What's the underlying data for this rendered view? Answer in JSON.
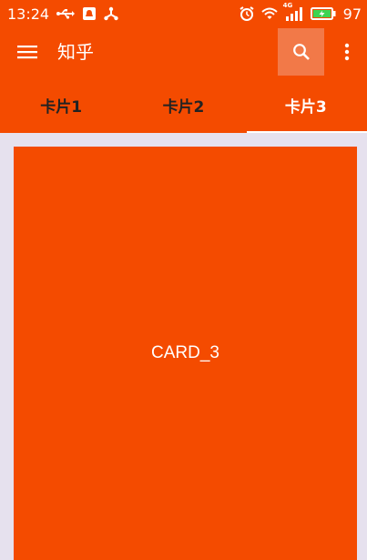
{
  "status_bar": {
    "time": "13:24",
    "battery": "97",
    "left_icons": [
      "usb-icon",
      "notification-icon",
      "share-icon"
    ],
    "right_icons": [
      "alarm-icon",
      "wifi-icon",
      "signal-icon",
      "battery-icon"
    ],
    "network_type": "4G"
  },
  "toolbar": {
    "title": "知乎",
    "menu_icon": "menu-icon",
    "search_icon": "search-icon",
    "more_icon": "more-vert-icon"
  },
  "tabs": [
    {
      "label": "卡片1",
      "active": false
    },
    {
      "label": "卡片2",
      "active": false
    },
    {
      "label": "卡片3",
      "active": true
    }
  ],
  "card": {
    "label": "CARD_3"
  },
  "colors": {
    "accent": "#f44b00",
    "background": "#e6e1ee",
    "search_highlight": "#f27948",
    "inactive_tab_text": "#222222",
    "active_tab_text": "#ffffff"
  }
}
